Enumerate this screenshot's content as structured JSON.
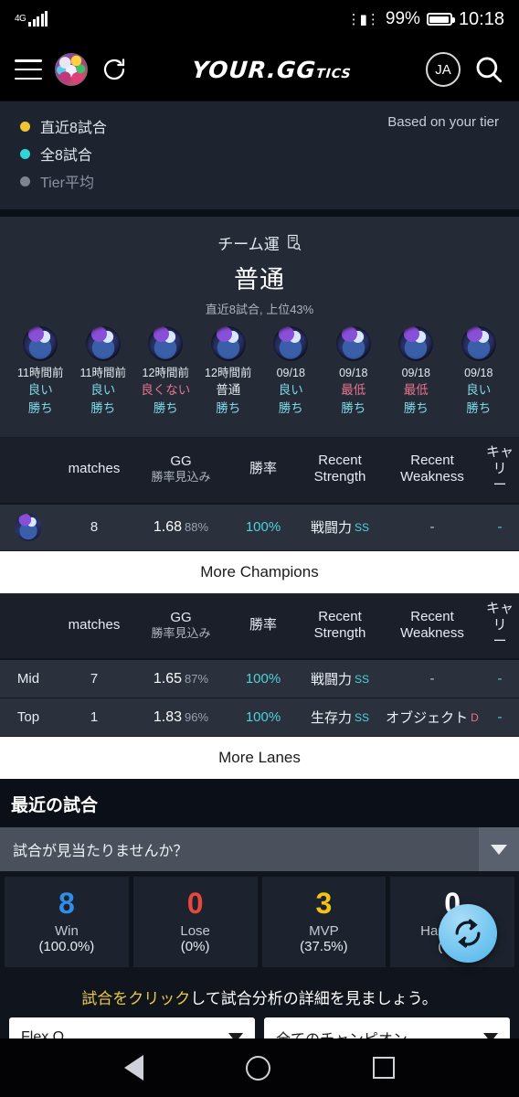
{
  "status_bar": {
    "network": "4G",
    "battery_percent": "99%",
    "time": "10:18",
    "vibrate_icon": "vibrate-icon"
  },
  "header": {
    "menu_icon": "hamburger-menu-icon",
    "avatar_icon": "profile-avatar",
    "refresh_icon": "refresh-icon",
    "logo_main": "YOUR.GG",
    "logo_suffix": "TICS",
    "account_initials": "JA",
    "search_icon": "search-icon"
  },
  "legend": {
    "based_on": "Based on your tier",
    "items": [
      {
        "label": "直近8試合",
        "color": "#f0c432"
      },
      {
        "label": "全8試合",
        "color": "#34d5d5"
      },
      {
        "label": "Tier平均",
        "color": "#7d848f"
      }
    ]
  },
  "team_luck": {
    "title": "チーム運",
    "info_icon": "document-search-icon",
    "value": "普通",
    "subtitle": "直近8試合, 上位43%",
    "matches": [
      {
        "time": "11時間前",
        "rating": "良い",
        "rating_tone": "good",
        "result": "勝ち"
      },
      {
        "time": "11時間前",
        "rating": "良い",
        "rating_tone": "good",
        "result": "勝ち"
      },
      {
        "time": "12時間前",
        "rating": "良くない",
        "rating_tone": "bad",
        "result": "勝ち"
      },
      {
        "time": "12時間前",
        "rating": "普通",
        "rating_tone": "neutral",
        "result": "勝ち"
      },
      {
        "time": "09/18",
        "rating": "良い",
        "rating_tone": "good",
        "result": "勝ち"
      },
      {
        "time": "09/18",
        "rating": "最低",
        "rating_tone": "bad",
        "result": "勝ち"
      },
      {
        "time": "09/18",
        "rating": "最低",
        "rating_tone": "bad",
        "result": "勝ち"
      },
      {
        "time": "09/18",
        "rating": "良い",
        "rating_tone": "good",
        "result": "勝ち"
      }
    ]
  },
  "columns": {
    "matches": "matches",
    "gg_main": "GG",
    "gg_sub": "勝率見込み",
    "winrate": "勝率",
    "recent_strength_l1": "Recent",
    "recent_strength_l2": "Strength",
    "recent_weakness_l1": "Recent",
    "recent_weakness_l2": "Weakness",
    "carry_l1": "キャリ",
    "carry_l2": "ー"
  },
  "champions_table": {
    "rows": [
      {
        "icon": "champion-icon",
        "matches": "8",
        "gg_value": "1.68",
        "gg_percent": "88%",
        "winrate": "100%",
        "strength_label": "戦闘力",
        "strength_grade": "SS",
        "weakness_label": "-",
        "carry": "-"
      }
    ],
    "more_button": "More Champions"
  },
  "lanes_table": {
    "rows": [
      {
        "lane": "Mid",
        "matches": "7",
        "gg_value": "1.65",
        "gg_percent": "87%",
        "winrate": "100%",
        "strength_label": "戦闘力",
        "strength_grade": "SS",
        "weakness_label": "-",
        "weakness_grade": "",
        "carry": "-"
      },
      {
        "lane": "Top",
        "matches": "1",
        "gg_value": "1.83",
        "gg_percent": "96%",
        "winrate": "100%",
        "strength_label": "生存力",
        "strength_grade": "SS",
        "weakness_label": "オブジェクト",
        "weakness_grade": "D",
        "carry": "-"
      }
    ],
    "more_button": "More Lanes"
  },
  "recent_matches": {
    "heading": "最近の試合",
    "not_found_label": "試合が見当たりませんか？",
    "dropdown_icon": "chevron-down-icon",
    "stats": [
      {
        "value": "8",
        "label": "Win",
        "percent": "(100.0%)",
        "color": "#2f8fe8"
      },
      {
        "value": "0",
        "label": "Lose",
        "percent": "(0%)",
        "color": "#e8483c"
      },
      {
        "value": "3",
        "label": "MVP",
        "percent": "(37.5%)",
        "color": "#f2c313"
      },
      {
        "value": "0",
        "label": "Hard Fight",
        "percent": "(0%)",
        "color": "#ffffff"
      }
    ],
    "hint_highlight": "試合をクリック",
    "hint_rest": "して試合分析の詳細を見ましょう。",
    "queue_select": "Flex Q.",
    "champion_select": "全てのチャンピオン",
    "refresh_fab_icon": "refresh-sync-icon"
  },
  "nav_bar": {
    "back_icon": "back-triangle-icon",
    "home_icon": "home-circle-icon",
    "recents_icon": "recents-square-icon"
  }
}
